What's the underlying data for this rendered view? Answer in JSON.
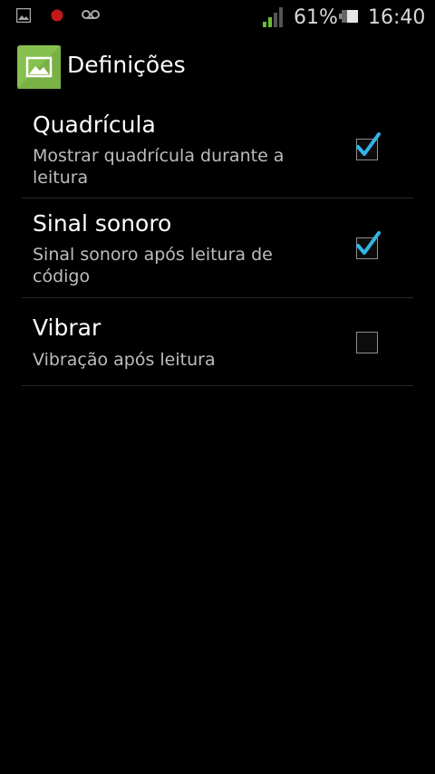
{
  "status_bar": {
    "battery_percent": "61%",
    "time": "16:40",
    "icons": [
      "image-notification-icon",
      "recording-dot-icon",
      "voicemail-icon",
      "signal-icon",
      "battery-icon"
    ],
    "colors": {
      "signal": "#6bbd35",
      "recording": "#c21a1a"
    }
  },
  "action_bar": {
    "title": "Definições",
    "icon": "image-app-icon",
    "colors": {
      "icon_bg": "#86c04e"
    }
  },
  "settings": [
    {
      "title": "Quadrícula",
      "summary": "Mostrar quadrícula durante a leitura",
      "checked": true
    },
    {
      "title": "Sinal sonoro",
      "summary": "Sinal sonoro após leitura de código",
      "checked": true
    },
    {
      "title": "Vibrar",
      "summary": "Vibração após leitura",
      "checked": false
    }
  ],
  "colors": {
    "check_accent": "#33b5e5",
    "divider": "#262626"
  }
}
